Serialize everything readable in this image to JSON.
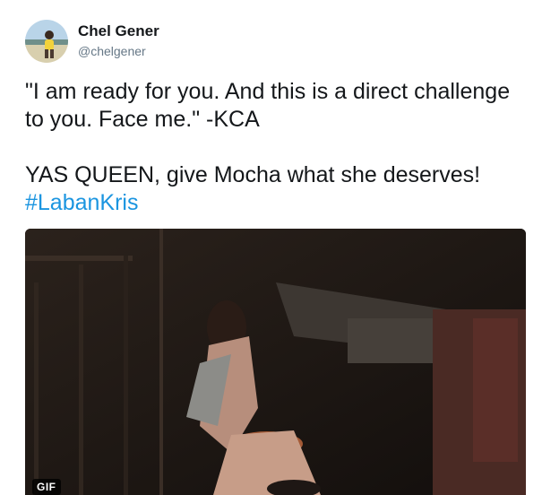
{
  "author": {
    "name": "Chel Gener",
    "handle": "@chelgener"
  },
  "tweet": {
    "line1": "\"I am ready for you. And this is a direct challenge to you. Face me.\" -KCA",
    "line2": "YAS QUEEN, give Mocha what she deserves!",
    "hashtag": "#LabanKris"
  },
  "media": {
    "badge": "GIF"
  },
  "colors": {
    "text": "#14171a",
    "secondary": "#657786",
    "link": "#1b95e0"
  }
}
